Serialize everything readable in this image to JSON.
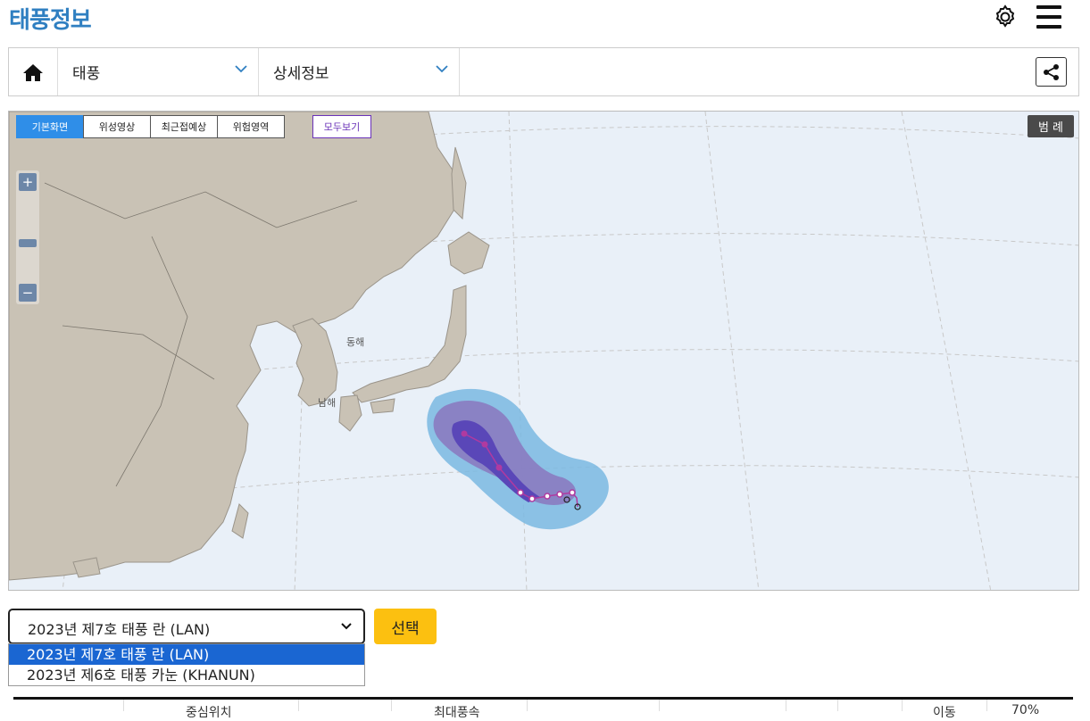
{
  "header": {
    "title": "태풍정보",
    "settings_icon": "gear-icon",
    "menu_icon": "hamburger-menu-icon"
  },
  "navbar": {
    "home_icon": "home-icon",
    "level1_label": "태풍",
    "level2_label": "상세정보",
    "share_icon": "share-icon"
  },
  "map": {
    "tabs": [
      {
        "label": "기본화면",
        "active": true
      },
      {
        "label": "위성영상",
        "active": false
      },
      {
        "label": "최근접예상",
        "active": false
      },
      {
        "label": "위험영역",
        "active": false
      }
    ],
    "all_view_label": "모두보기",
    "legend_label": "범 례",
    "zoom_in": "+",
    "zoom_out": "−",
    "labels": {
      "east_sea": "동해",
      "south_sea": "남해"
    },
    "colors": {
      "sea": "#e9f0f8",
      "land": "#c9c2b5",
      "risk_outer": "#6fb3e0",
      "risk_inner": "#8a7bc0",
      "track_core": "#5a47b8"
    }
  },
  "typhoon_select": {
    "current_value": "2023년 제7호 태풍 란 (LAN)",
    "options": [
      {
        "label": "2023년 제7호 태풍 란 (LAN)",
        "selected": true
      },
      {
        "label": "2023년 제6호 태풍 카눈 (KHANUN)",
        "selected": false
      }
    ],
    "button_label": "선택"
  },
  "table": {
    "headers": [
      "중심위치",
      "최대풍속",
      "이동",
      "70%"
    ]
  }
}
